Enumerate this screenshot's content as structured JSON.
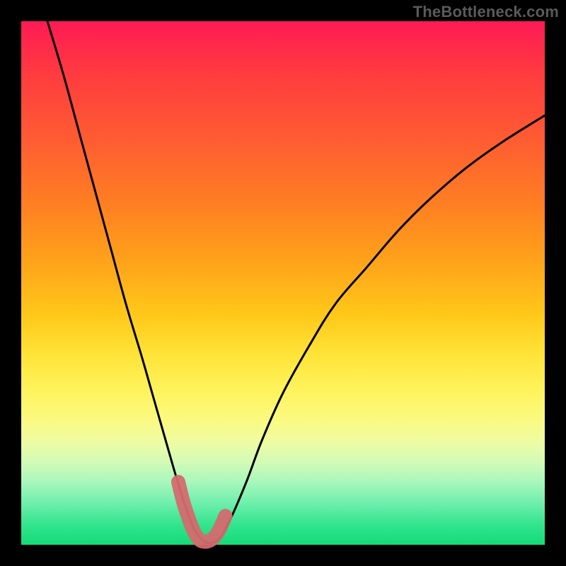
{
  "watermark": "TheBottleneck.com",
  "colors": {
    "curve_stroke": "#000000",
    "marker_stroke": "#d46a6f",
    "background_black": "#000000"
  },
  "chart_data": {
    "type": "line",
    "title": "",
    "xlabel": "",
    "ylabel": "",
    "xlim": [
      0,
      100
    ],
    "ylim": [
      0,
      100
    ],
    "grid": false,
    "legend": false,
    "series": [
      {
        "name": "bottleneck-curve",
        "x": [
          5,
          8,
          11,
          14,
          17,
          20,
          23,
          25,
          27,
          29,
          30.5,
          32,
          33.5,
          35,
          36.5,
          38,
          40,
          43,
          46,
          50,
          55,
          60,
          66,
          72,
          78,
          85,
          92,
          100
        ],
        "y": [
          100,
          90,
          79,
          68,
          57,
          46,
          36,
          29,
          22,
          15,
          10,
          5.5,
          2.2,
          0.6,
          0.4,
          1.4,
          5,
          12,
          20,
          29,
          38,
          46,
          53,
          60,
          66,
          72,
          77,
          82
        ]
      }
    ],
    "markers": {
      "name": "highlight-segment",
      "x": [
        30,
        31,
        32,
        33,
        34,
        35,
        36,
        37,
        38,
        39
      ],
      "y": [
        12,
        8,
        5,
        2.5,
        1,
        0.6,
        0.8,
        1.6,
        3.2,
        5.5
      ]
    }
  }
}
